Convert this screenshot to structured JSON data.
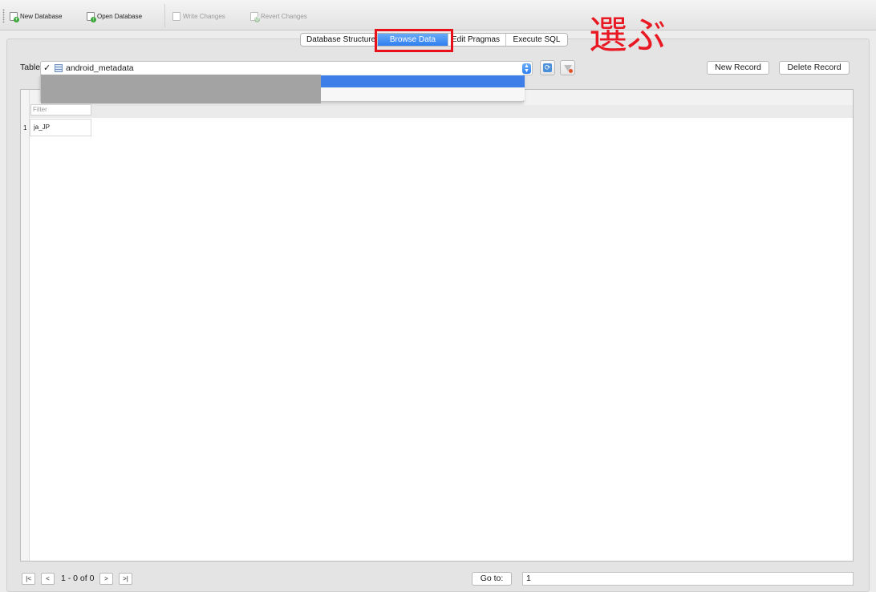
{
  "toolbar": {
    "new_database": "New Database",
    "open_database": "Open Database",
    "write_changes": "Write Changes",
    "revert_changes": "Revert Changes"
  },
  "tabs": [
    {
      "label": "Database Structure",
      "active": false
    },
    {
      "label": "Browse Data",
      "active": true
    },
    {
      "label": "Edit Pragmas",
      "active": false
    },
    {
      "label": "Execute SQL",
      "active": false
    }
  ],
  "annotation": {
    "text": "選ぶ",
    "color": "#e81922"
  },
  "browse": {
    "table_label": "Table:",
    "check_mark": "✓",
    "selected_table": "android_metadata",
    "new_record": "New Record",
    "delete_record": "Delete Record"
  },
  "grid": {
    "filter_placeholder": "Filter",
    "rows": [
      {
        "number": "1",
        "value": "ja_JP"
      }
    ]
  },
  "pager": {
    "first": "|<",
    "prev": "<",
    "info": "1 - 0 of 0",
    "next": ">",
    "last": ">|",
    "goto_label": "Go to:",
    "goto_value": "1"
  },
  "colors": {
    "accent": "#3d7ee8",
    "highlight_box": "#e8101a"
  }
}
